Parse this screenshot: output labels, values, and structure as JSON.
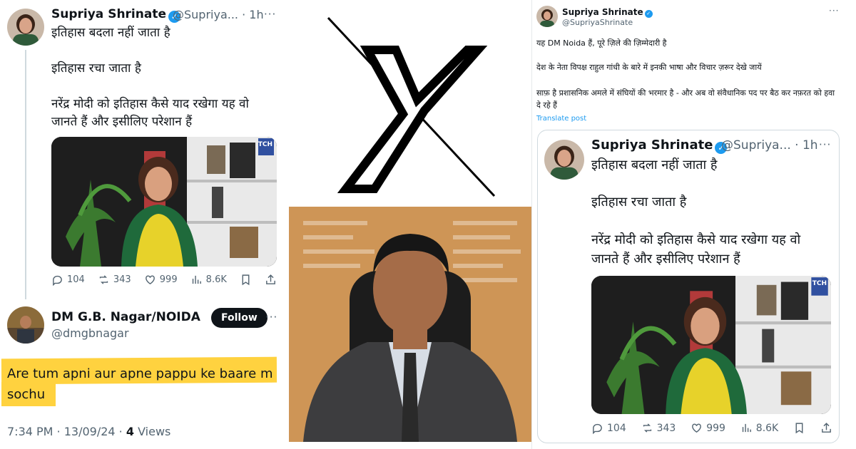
{
  "left_tweet": {
    "author_name": "Supriya Shrinate",
    "author_handle": "@Supriya...",
    "time": "1h",
    "more": "···",
    "verified": "✓",
    "line1": "इतिहास बदला नहीं जाता है",
    "line2": "इतिहास रचा जाता है",
    "line3": "नरेंद्र मोदी को इतिहास कैसे याद रखेगा यह वो\nजानते हैं और इसीलिए परेशान हैं",
    "media_overlay_tag": "TCH",
    "stats": {
      "replies": "104",
      "reposts": "343",
      "likes": "999",
      "views": "8.6K"
    }
  },
  "reply_tweet": {
    "author_name": "DM G.B. Nagar/NOIDA",
    "author_handle": "@dmgbnagar",
    "follow_label": "Follow",
    "more": "···",
    "text_line1": "Are tum apni aur apne pappu ke baare m",
    "text_line2": "sochu",
    "timestamp": "7:34 PM · 13/09/24 · ",
    "views_count": "4",
    "views_label": " Views",
    "highlight_color": "#ffd23f"
  },
  "right_tweet": {
    "author_name": "Supriya Shrinate",
    "author_handle": "@SupriyaShrinate",
    "verified": "✓",
    "more": "···",
    "para1": "यह DM Noida हैं, पूरे ज़िले की ज़िम्मेदारी है",
    "para2": "देश के नेता विपक्ष राहुल गांधी के बारे में इनकी भाषा और विचार ज़रूर देखे जायें",
    "para3": "साफ़ है प्रशासनिक अमले में संघियों की भरमार है - और अब वो संवैधानिक पद पर बैठ कर नफ़रत को हवा दे रहे हैं",
    "translate_label": "Translate post",
    "quoted": {
      "author_name": "Supriya Shrinate",
      "author_handle": "@Supriya...",
      "time": "1h",
      "more": "···",
      "verified": "✓",
      "line1": "इतिहास बदला नहीं जाता है",
      "line2": "इतिहास रचा जाता है",
      "line3": "नरेंद्र मोदी को इतिहास कैसे याद रखेगा यह वो\nजानते हैं और इसीलिए परेशान हैं",
      "media_overlay_tag": "TCH",
      "stats": {
        "replies": "104",
        "reposts": "343",
        "likes": "999",
        "views": "8.6K"
      }
    }
  },
  "colors": {
    "accent": "#1d9bf0",
    "text": "#0f1419",
    "muted": "#536471",
    "border": "#cfd9de"
  }
}
